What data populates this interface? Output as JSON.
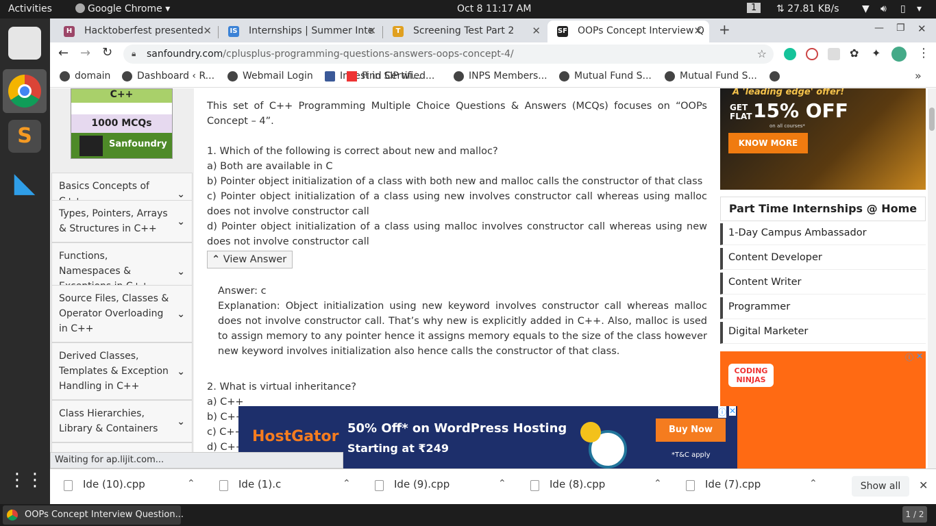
{
  "topbar": {
    "activities": "Activities",
    "app_menu": "Google Chrome",
    "clock": "Oct 8  11:17 AM",
    "workspace": "1",
    "net_speed": "⇅ 27.81 KB/s"
  },
  "tabs": [
    {
      "label": "Hacktoberfest presented",
      "favicon": "H",
      "color": "#9c4668"
    },
    {
      "label": "Internships | Summer Inte",
      "favicon": "IS",
      "color": "#3b82d6"
    },
    {
      "label": "Screening Test Part 2",
      "favicon": "T",
      "color": "#e0a020"
    },
    {
      "label": "OOPs Concept Interview Q",
      "favicon": "SF",
      "color": "#222"
    }
  ],
  "toolbar": {
    "url_domain": "sanfoundry.com",
    "url_path": "/cplusplus-programming-questions-answers-oops-concept-4/"
  },
  "bookmarks": [
    "domain",
    "Dashboard ‹ R...",
    "Webmail Login",
    "Invest in SIP wi...",
    "Find Certified...",
    "INPS Members...",
    "Mutual Fund S...",
    "Mutual Fund S..."
  ],
  "book": {
    "lang": "C++",
    "count": "1000 MCQs",
    "brand": "Sanfoundry"
  },
  "sidebar": [
    "Basics Concepts of C++",
    "Types, Pointers, Arrays & Structures in C++",
    "Functions, Namespaces & Exceptions in C++",
    "Source Files, Classes & Operator Overloading in C++",
    "Derived Classes, Templates & Exception Handling in C++",
    "Class Hierarchies, Library & Containers"
  ],
  "content": {
    "intro": "This set of C++ Programming Multiple Choice Questions & Answers (MCQs) focuses on “OOPs Concept – 4”.",
    "q1": "1. Which of the following is correct about new and malloc?",
    "q1_a": "a) Both are available in C",
    "q1_b": "b) Pointer object initialization of a class with both new and malloc calls the constructor of that class",
    "q1_c": "c) Pointer object initialization of a class using new involves constructor call whereas using malloc does not involve constructor call",
    "q1_d": "d) Pointer object initialization of a class using malloc involves constructor call whereas using new does not involve constructor call",
    "view_answer": "View Answer",
    "answer": "Answer: c",
    "explanation": "Explanation: Object initialization using new keyword involves constructor call whereas malloc does not involve constructor call. That’s why new is explicitly added in C++. Also, malloc is used to assign memory to any pointer hence it assigns memory equals to the size of the class however new keyword involves initialization also hence calls the constructor of that class.",
    "q2": "2. What is virtual inheritance?",
    "q2_a": "a) C++",
    "q2_b": "b) C++",
    "q2_c": "c) C++",
    "q2_d": "d) C++"
  },
  "right": {
    "ad_tag": "A 'leading edge' offer!",
    "ad_get": "GET FLAT",
    "ad_off": "15% OFF",
    "ad_sub": "on all courses*",
    "ad_btn": "KNOW MORE",
    "intern_title": "Part Time Internships @ Home",
    "intern_links": [
      "1-Day Campus Ambassador",
      "Content Developer",
      "Content Writer",
      "Programmer",
      "Digital Marketer"
    ],
    "ad2_brand": "CODING NINJAS"
  },
  "hostgator": {
    "brand": "HostGator",
    "line1": "50% Off* on WordPress Hosting",
    "line2": "Starting at ₹249",
    "btn": "Buy Now",
    "tc": "*T&C apply"
  },
  "status": "Waiting for ap.lijit.com...",
  "downloads": [
    "Ide (10).cpp",
    "Ide (1).c",
    "Ide (9).cpp",
    "Ide (8).cpp",
    "Ide (7).cpp"
  ],
  "show_all": "Show all",
  "taskbar": {
    "window": "OOPs Concept Interview Question...",
    "pager": "1 / 2"
  },
  "colors": {
    "accent": "#1a73e8",
    "hostgator_blue": "#1d2f6b",
    "hostgator_orange": "#f57c1f",
    "ad_orange": "#ff6a13"
  }
}
